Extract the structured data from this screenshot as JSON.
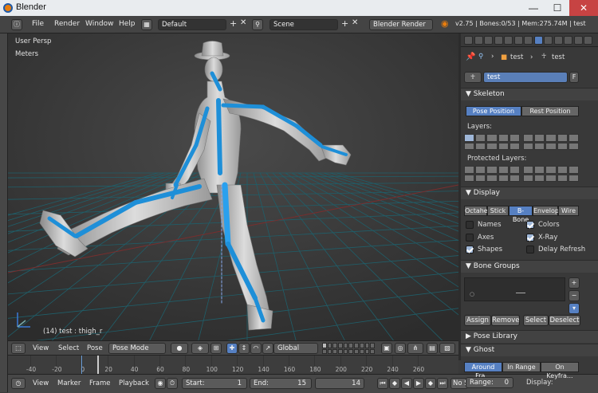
{
  "window": {
    "title": "Blender",
    "min": "—",
    "max": "☐",
    "close": "✕"
  },
  "info_header": {
    "menus": [
      "File",
      "Render",
      "Window",
      "Help"
    ],
    "screen_layout": "Default",
    "scene": "Scene",
    "render_engine": "Blender Render",
    "stats": "v2.75 | Bones:0/53 | Mem:275.74M | test"
  },
  "viewport": {
    "view_label": "User Persp",
    "units": "Meters",
    "status": "(14) test : thigh_r",
    "colors": {
      "background": "#393939",
      "grid": "#1f5f6a",
      "bones": "#1e8fd8",
      "mesh": "#c8c8c8"
    }
  },
  "viewport_header": {
    "menus": [
      "View",
      "Select",
      "Pose"
    ],
    "mode": "Pose Mode",
    "orientation": "Global"
  },
  "timeline": {
    "ticks": [
      "-40",
      "-20",
      "0",
      "20",
      "40",
      "60",
      "80",
      "100",
      "120",
      "140",
      "160",
      "180",
      "200",
      "220",
      "240",
      "260"
    ],
    "menus": [
      "View",
      "Marker",
      "Frame",
      "Playback"
    ],
    "start_label": "Start:",
    "start_value": "1",
    "end_label": "End:",
    "end_value": "15",
    "current_frame": "14",
    "sync": "No S"
  },
  "properties": {
    "context_object": "test",
    "context_armature": "test",
    "armature_name": "test",
    "fake_user": "F",
    "skeleton": {
      "title": "Skeleton",
      "pose_position": "Pose Position",
      "rest_position": "Rest Position",
      "layers_label": "Layers:",
      "protected_label": "Protected Layers:"
    },
    "display": {
      "title": "Display",
      "types": [
        "Octahe",
        "Stick",
        "B-Bone",
        "Envelop",
        "Wire"
      ],
      "active_type": "B-Bone",
      "options_left": [
        {
          "label": "Names",
          "on": false
        },
        {
          "label": "Axes",
          "on": false
        },
        {
          "label": "Shapes",
          "on": true
        }
      ],
      "options_right": [
        {
          "label": "Colors",
          "on": true
        },
        {
          "label": "X-Ray",
          "on": true
        },
        {
          "label": "Delay Refresh",
          "on": false
        }
      ]
    },
    "bone_groups": {
      "title": "Bone Groups",
      "add": "+",
      "remove": "−",
      "assign": "Assign",
      "remove_btn": "Remove",
      "select": "Select",
      "deselect": "Deselect"
    },
    "pose_library": {
      "title": "Pose Library"
    },
    "ghost": {
      "title": "Ghost",
      "modes": [
        "Around Fra...",
        "In Range",
        "On Keyfra..."
      ],
      "range_label": "Range:",
      "range_value": "0",
      "display_label": "Display:"
    }
  }
}
